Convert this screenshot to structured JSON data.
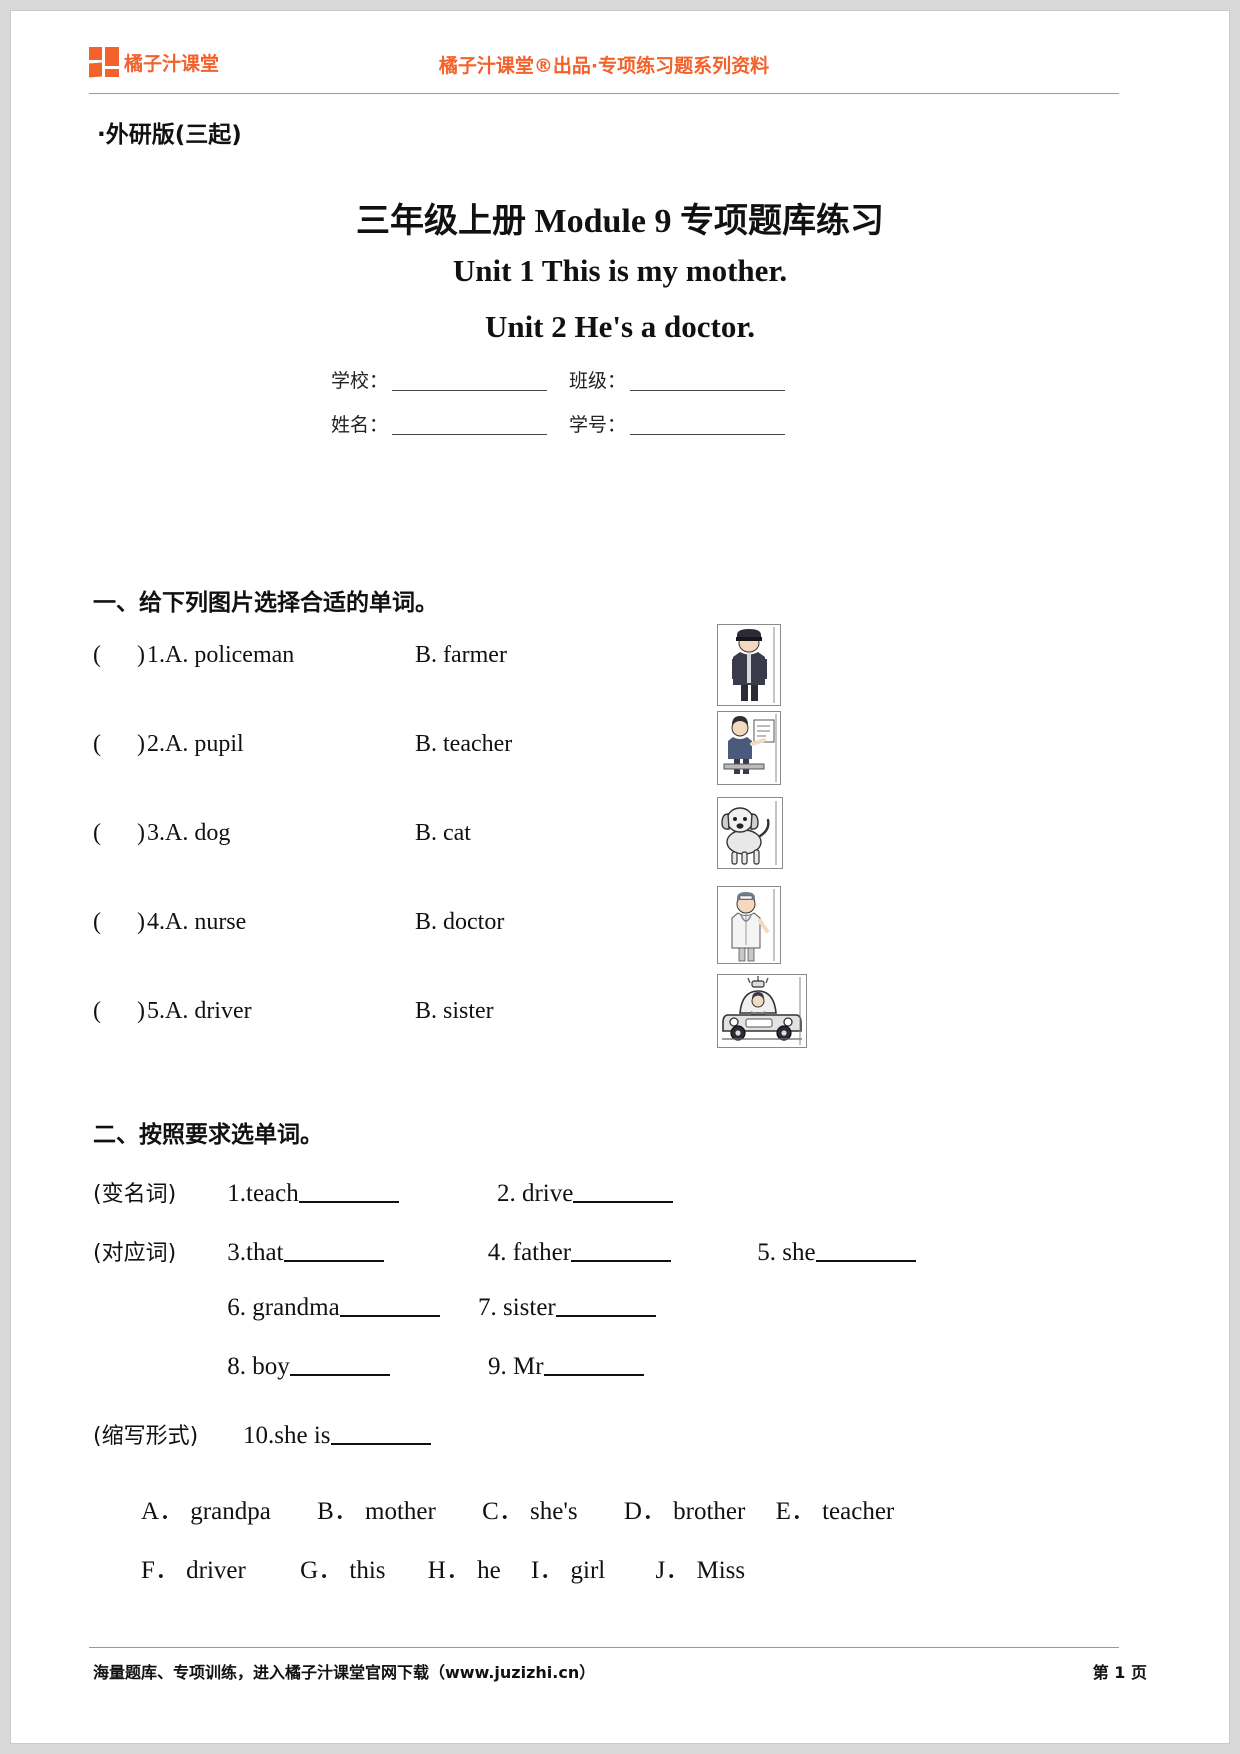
{
  "header": {
    "logo_text": "橘子汁课堂",
    "logo_icon": "orange-squares-logo-icon",
    "center_text": "橘子汁课堂®出品·专项练习题系列资料",
    "brand_color": "#F4622B"
  },
  "edition": "·外研版(三起)",
  "titles": {
    "main": "三年级上册 Module 9 专项题库练习",
    "sub1": "Unit 1 This is my mother.",
    "sub2": "Unit 2 He's a doctor."
  },
  "info_fields": [
    {
      "label": "学校：",
      "value": ""
    },
    {
      "label": "班级：",
      "value": ""
    },
    {
      "label": "姓名：",
      "value": ""
    },
    {
      "label": "学号：",
      "value": ""
    }
  ],
  "section_one": {
    "heading": "一、给下列图片选择合适的单词。",
    "questions": [
      {
        "paren": "(      )",
        "num": "1.",
        "a": "A. policeman",
        "b": "B. farmer",
        "image": "policeman-photo"
      },
      {
        "paren": "(      )",
        "num": "2.",
        "a": "A. pupil",
        "b": "B. teacher",
        "image": "teacher-photo"
      },
      {
        "paren": "(      )",
        "num": "3.",
        "a": "A. dog",
        "b": "B. cat",
        "image": "dog-photo"
      },
      {
        "paren": "(      )",
        "num": "4.",
        "a": "A. nurse",
        "b": "B. doctor",
        "image": "doctor-photo"
      },
      {
        "paren": "(      )",
        "num": "5.",
        "a": "A. driver",
        "b": "B. sister",
        "image": "driver-car-photo"
      }
    ]
  },
  "section_two": {
    "heading": "二、按照要求选单词。",
    "rows": [
      {
        "tag": "(变名词)",
        "items": [
          {
            "num": "1.",
            "word": "teach"
          },
          {
            "num": "2.",
            "word": "drive"
          }
        ]
      },
      {
        "tag": "(对应词)",
        "items": [
          {
            "num": "3.",
            "word": "that"
          },
          {
            "num": "4.",
            "word": "father"
          },
          {
            "num": "5.",
            "word": "she"
          }
        ]
      },
      {
        "tag": "",
        "items": [
          {
            "num": "6.",
            "word": "grandma"
          },
          {
            "num": "7.",
            "word": "sister"
          }
        ]
      },
      {
        "tag": "",
        "items": [
          {
            "num": "8.",
            "word": "boy"
          },
          {
            "num": "9.",
            "word": "Mr"
          }
        ]
      },
      {
        "tag": "(缩写形式)",
        "items": [
          {
            "num": "10.",
            "word": "she is"
          }
        ]
      }
    ],
    "word_bank": [
      [
        "A． grandpa",
        "B． mother",
        "C． she's",
        "D． brother",
        "E． teacher"
      ],
      [
        "F． driver",
        "G． this",
        "H． he",
        "I． girl",
        "J． Miss"
      ]
    ]
  },
  "footer": {
    "left": "海量题库、专项训练，进入橘子汁课堂官网下载（www.juzizhi.cn）",
    "right": "第 1 页"
  }
}
